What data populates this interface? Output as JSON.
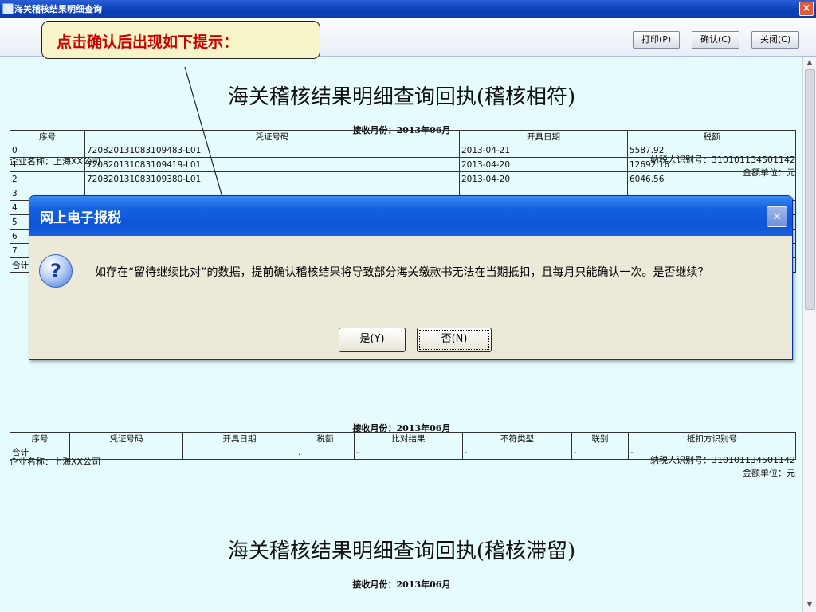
{
  "window": {
    "title": "海关稽核结果明细查询"
  },
  "toolbar": {
    "print_label": "打印(P)",
    "confirm_label": "确认(C)",
    "close_label": "关闭(C)"
  },
  "callout": {
    "text": "点击确认后出现如下提示："
  },
  "receipt1": {
    "title": "海关稽核结果明细查询回执(稽核相符)",
    "month": "接收月份：2013年06月",
    "company": "企业名称：上海XX公司",
    "taxid": "纳税人识别号：310101134501142",
    "unit": "金额单位：元",
    "headers": [
      "序号",
      "凭证号码",
      "开具日期",
      "税额"
    ],
    "rows": [
      [
        "0",
        "720820131083109483-L01",
        "2013-04-21",
        "5587.92"
      ],
      [
        "1",
        "720820131083109419-L01",
        "2013-04-20",
        "12692.16"
      ],
      [
        "2",
        "720820131083109380-L01",
        "2013-04-20",
        "6046.56"
      ],
      [
        "3",
        "",
        "",
        ""
      ],
      [
        "4",
        "",
        "",
        ""
      ],
      [
        "5",
        "",
        "",
        ""
      ],
      [
        "6",
        "",
        "",
        ""
      ],
      [
        "7",
        "",
        "",
        ""
      ],
      [
        "合计",
        "",
        "",
        ""
      ]
    ]
  },
  "receipt2": {
    "month": "接收月份：2013年06月",
    "company": "企业名称：上海XX公司",
    "taxid": "纳税人识别号：310101134501142",
    "unit": "金额单位：元",
    "headers": [
      "序号",
      "凭证号码",
      "开具日期",
      "税额",
      "比对结果",
      "不符类型",
      "联别",
      "抵扣方识别号"
    ],
    "total_row": [
      "合计",
      "",
      "",
      ".",
      "-",
      "-",
      "-",
      "-"
    ]
  },
  "receipt3": {
    "title": "海关稽核结果明细查询回执(稽核滞留)",
    "month": "接收月份：2013年06月"
  },
  "dialog": {
    "title": "网上电子报税",
    "message": "如存在“留待继续比对”的数据，提前确认稽核结果将导致部分海关缴款书无法在当期抵扣，且每月只能确认一次。是否继续？",
    "yes_label": "是(Y)",
    "no_label": "否(N)"
  }
}
